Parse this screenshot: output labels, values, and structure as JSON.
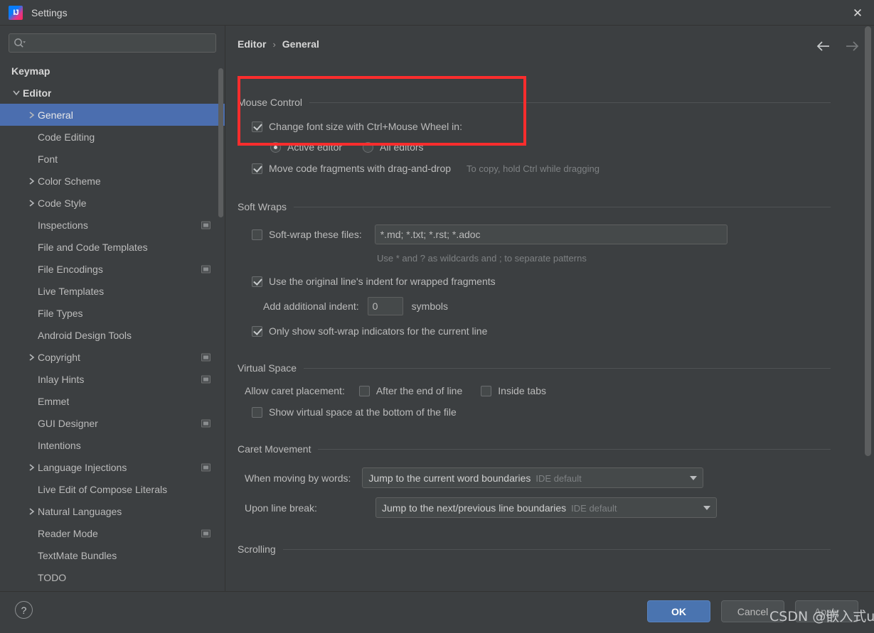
{
  "window": {
    "title": "Settings",
    "app_icon": "intellij-idea-icon",
    "close_icon": "close-icon"
  },
  "sidebar": {
    "search": {
      "value": "",
      "placeholder": "",
      "icon": "search-icon"
    },
    "items": [
      {
        "label": "Keymap",
        "level": 0,
        "arrow": "none",
        "bold": true,
        "selected": false,
        "badge": false
      },
      {
        "label": "Editor",
        "level": 0,
        "arrow": "expanded",
        "bold": true,
        "selected": false,
        "badge": false
      },
      {
        "label": "General",
        "level": 1,
        "arrow": "collapsed",
        "bold": false,
        "selected": true,
        "badge": false
      },
      {
        "label": "Code Editing",
        "level": 1,
        "arrow": "none",
        "bold": false,
        "selected": false,
        "badge": false
      },
      {
        "label": "Font",
        "level": 1,
        "arrow": "none",
        "bold": false,
        "selected": false,
        "badge": false
      },
      {
        "label": "Color Scheme",
        "level": 1,
        "arrow": "collapsed",
        "bold": false,
        "selected": false,
        "badge": false
      },
      {
        "label": "Code Style",
        "level": 1,
        "arrow": "collapsed",
        "bold": false,
        "selected": false,
        "badge": false
      },
      {
        "label": "Inspections",
        "level": 1,
        "arrow": "none",
        "bold": false,
        "selected": false,
        "badge": true
      },
      {
        "label": "File and Code Templates",
        "level": 1,
        "arrow": "none",
        "bold": false,
        "selected": false,
        "badge": false
      },
      {
        "label": "File Encodings",
        "level": 1,
        "arrow": "none",
        "bold": false,
        "selected": false,
        "badge": true
      },
      {
        "label": "Live Templates",
        "level": 1,
        "arrow": "none",
        "bold": false,
        "selected": false,
        "badge": false
      },
      {
        "label": "File Types",
        "level": 1,
        "arrow": "none",
        "bold": false,
        "selected": false,
        "badge": false
      },
      {
        "label": "Android Design Tools",
        "level": 1,
        "arrow": "none",
        "bold": false,
        "selected": false,
        "badge": false
      },
      {
        "label": "Copyright",
        "level": 1,
        "arrow": "collapsed",
        "bold": false,
        "selected": false,
        "badge": true
      },
      {
        "label": "Inlay Hints",
        "level": 1,
        "arrow": "none",
        "bold": false,
        "selected": false,
        "badge": true
      },
      {
        "label": "Emmet",
        "level": 1,
        "arrow": "none",
        "bold": false,
        "selected": false,
        "badge": false
      },
      {
        "label": "GUI Designer",
        "level": 1,
        "arrow": "none",
        "bold": false,
        "selected": false,
        "badge": true
      },
      {
        "label": "Intentions",
        "level": 1,
        "arrow": "none",
        "bold": false,
        "selected": false,
        "badge": false
      },
      {
        "label": "Language Injections",
        "level": 1,
        "arrow": "collapsed",
        "bold": false,
        "selected": false,
        "badge": true
      },
      {
        "label": "Live Edit of Compose Literals",
        "level": 1,
        "arrow": "none",
        "bold": false,
        "selected": false,
        "badge": false
      },
      {
        "label": "Natural Languages",
        "level": 1,
        "arrow": "collapsed",
        "bold": false,
        "selected": false,
        "badge": false
      },
      {
        "label": "Reader Mode",
        "level": 1,
        "arrow": "none",
        "bold": false,
        "selected": false,
        "badge": true
      },
      {
        "label": "TextMate Bundles",
        "level": 1,
        "arrow": "none",
        "bold": false,
        "selected": false,
        "badge": false
      },
      {
        "label": "TODO",
        "level": 1,
        "arrow": "none",
        "bold": false,
        "selected": false,
        "badge": false
      }
    ]
  },
  "header": {
    "breadcrumb_root": "Editor",
    "breadcrumb_sep": "›",
    "breadcrumb_leaf": "General",
    "back_icon": "arrow-left-icon",
    "forward_icon": "arrow-right-icon"
  },
  "sections": {
    "mouse_control": {
      "title": "Mouse Control",
      "change_font_size": {
        "label": "Change font size with Ctrl+Mouse Wheel in:",
        "checked": true
      },
      "scope_active": {
        "label": "Active editor",
        "selected": true
      },
      "scope_all": {
        "label": "All editors",
        "selected": false
      },
      "move_fragments": {
        "label": "Move code fragments with drag-and-drop",
        "checked": true
      },
      "move_fragments_hint": "To copy, hold Ctrl while dragging"
    },
    "soft_wraps": {
      "title": "Soft Wraps",
      "soft_wrap_files": {
        "label": "Soft-wrap these files:",
        "checked": false,
        "value": "*.md; *.txt; *.rst; *.adoc"
      },
      "wildcard_hint": "Use * and ? as wildcards and ; to separate patterns",
      "original_indent": {
        "label": "Use the original line's indent for wrapped fragments",
        "checked": true
      },
      "additional_indent_label": "Add additional indent:",
      "additional_indent_value": "0",
      "additional_indent_suffix": "symbols",
      "only_show_indicators": {
        "label": "Only show soft-wrap indicators for the current line",
        "checked": true
      }
    },
    "virtual_space": {
      "title": "Virtual Space",
      "allow_caret_label": "Allow caret placement:",
      "after_end_of_line": {
        "label": "After the end of line",
        "checked": false
      },
      "inside_tabs": {
        "label": "Inside tabs",
        "checked": false
      },
      "show_virtual_space": {
        "label": "Show virtual space at the bottom of the file",
        "checked": false
      }
    },
    "caret_movement": {
      "title": "Caret Movement",
      "when_moving_label": "When moving by words:",
      "when_moving_value": "Jump to the current word boundaries",
      "when_moving_default": "IDE default",
      "upon_line_break_label": "Upon line break:",
      "upon_line_break_value": "Jump to the next/previous line boundaries",
      "upon_line_break_default": "IDE default"
    },
    "scrolling": {
      "title": "Scrolling"
    }
  },
  "footer": {
    "help_label": "?",
    "ok": "OK",
    "cancel": "Cancel",
    "apply": "Apply"
  },
  "watermark": {
    "text": "CSDN @嵌入式up"
  },
  "colors": {
    "accent_blue": "#4b6eaf",
    "ok_button": "#4a74b0",
    "annotation_red": "#fc2d2d",
    "panel_bg": "#3c3f41",
    "field_bg": "#45494a"
  }
}
